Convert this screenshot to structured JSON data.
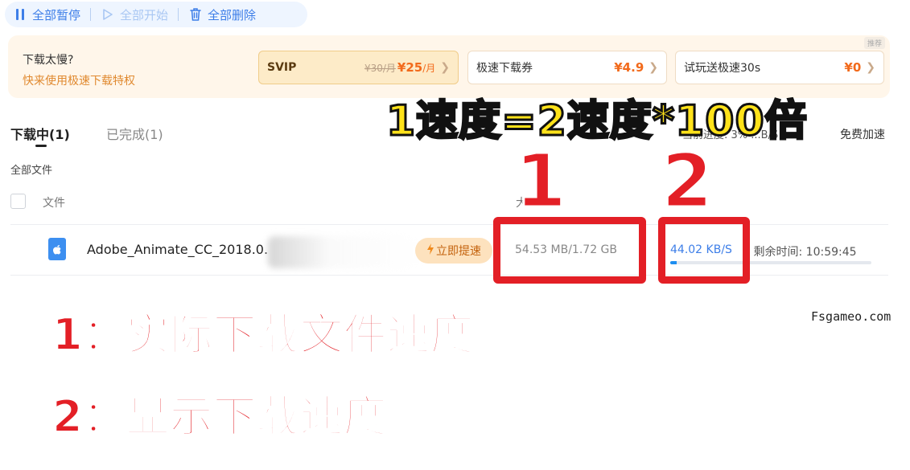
{
  "toolbar": {
    "pause_all": "全部暂停",
    "start_all": "全部开始",
    "delete_all": "全部删除"
  },
  "promo": {
    "title": "下载太慢?",
    "subtitle": "快来使用极速下载特权",
    "tag": "推荐",
    "cards": [
      {
        "name": "SVIP",
        "old_price": "¥30/月",
        "price": "¥25",
        "unit": "/月"
      },
      {
        "name": "极速下载券",
        "price": "¥4.9"
      },
      {
        "name": "试玩送极速30s",
        "price": "¥0"
      }
    ]
  },
  "tabs": {
    "downloading": "下载中(1)",
    "completed": "已完成(1)"
  },
  "progress_info": "当前进度: 3%  ...B/S",
  "free_accel": "免费加速",
  "all_files": "全部文件",
  "table": {
    "col_file": "文件",
    "col_size": "大小"
  },
  "row": {
    "file_name": "Adobe_Animate_CC_2018.0.",
    "speedup": "立即提速",
    "size": "54.53 MB/1.72 GB",
    "speed": "44.02 KB/S",
    "remaining": "- 剩余时间: 10:59:45",
    "progress_pct": 3
  },
  "annotations": {
    "headline": "1速度=2速度*100倍",
    "num1": "1",
    "num2": "2",
    "line1": "1：实际下载文件速度",
    "line2": "2：显示下载速度"
  },
  "watermark": "Fsgameo.com",
  "colors": {
    "accent": "#3d7ee8",
    "promo_bg": "#fff6ea",
    "annotation_red": "#e31f26",
    "annotation_yellow": "#ffe21a"
  }
}
